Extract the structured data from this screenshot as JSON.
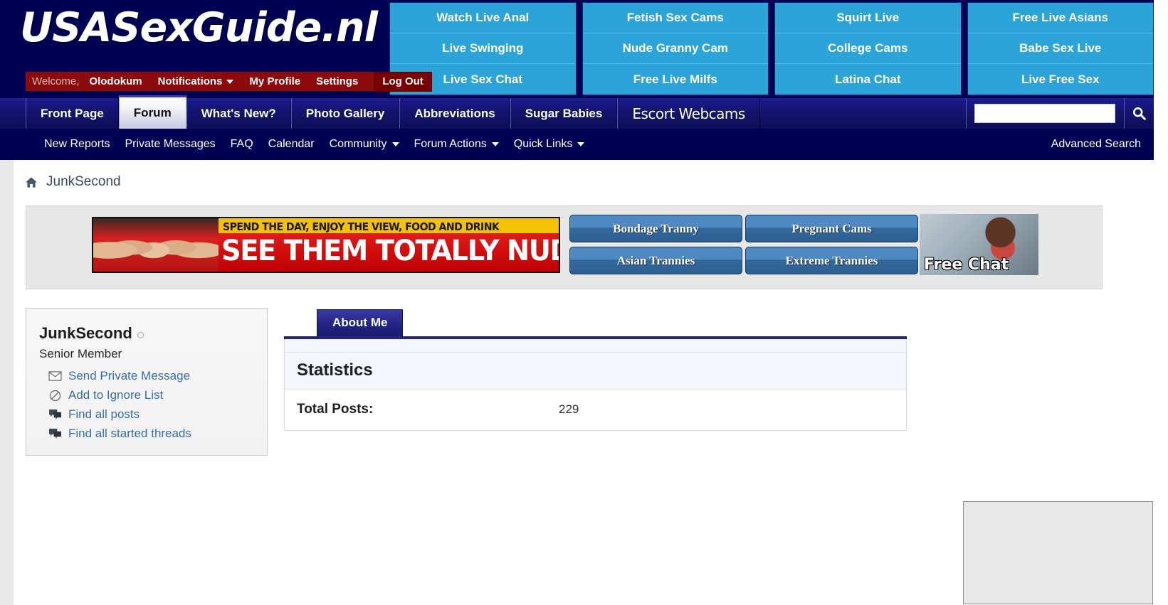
{
  "site": {
    "logo": "USASexGuide.nl"
  },
  "welcome_bar": {
    "greeting": "Welcome,",
    "username": "Olodokum",
    "items": [
      {
        "label": "Notifications",
        "icon": "chevron-down-icon",
        "has_caret": true
      },
      {
        "label": "My Profile",
        "has_caret": false
      },
      {
        "label": "Settings",
        "has_caret": false
      }
    ],
    "logout_label": "Log Out"
  },
  "top_ads": {
    "columns": [
      {
        "cells": [
          "Watch Live Anal",
          "Live Swinging",
          "Live Sex Chat"
        ]
      },
      {
        "cells": [
          "Fetish Sex Cams",
          "Nude Granny Cam",
          "Free Live Milfs"
        ]
      },
      {
        "cells": [
          "Squirt Live",
          "College Cams",
          "Latina Chat"
        ]
      },
      {
        "cells": [
          "Free Live Asians",
          "Babe Sex Live",
          "Live Free Sex"
        ]
      }
    ],
    "background_color": "#2ca3d9"
  },
  "nav": {
    "tabs": [
      {
        "label": "Front Page",
        "active": false,
        "style": "normal"
      },
      {
        "label": "Forum",
        "active": true,
        "style": "normal"
      },
      {
        "label": "What's New?",
        "active": false,
        "style": "normal"
      },
      {
        "label": "Photo Gallery",
        "active": false,
        "style": "normal"
      },
      {
        "label": "Abbreviations",
        "active": false,
        "style": "normal"
      },
      {
        "label": "Sugar Babies",
        "active": false,
        "style": "normal"
      },
      {
        "label": "Escort Webcams",
        "active": false,
        "style": "script"
      }
    ],
    "search": {
      "value": "",
      "placeholder": "",
      "button_icon": "search-icon"
    }
  },
  "subnav": {
    "items": [
      {
        "label": "New Reports",
        "has_caret": false
      },
      {
        "label": "Private Messages",
        "has_caret": false
      },
      {
        "label": "FAQ",
        "has_caret": false
      },
      {
        "label": "Calendar",
        "has_caret": false
      },
      {
        "label": "Community",
        "has_caret": true
      },
      {
        "label": "Forum Actions",
        "has_caret": true
      },
      {
        "label": "Quick Links",
        "has_caret": true
      }
    ],
    "advanced_search": "Advanced Search"
  },
  "breadcrumb": {
    "home_icon": "home-icon",
    "label": "JunkSecond"
  },
  "ad_strip": {
    "banner": {
      "line1": "SPEND THE DAY, ENJOY THE VIEW, FOOD AND DRINK",
      "line2": "SEE THEM TOTALLY NUDE"
    },
    "buttons": [
      "Bondage Tranny",
      "Pregnant Cams",
      "Asian Trannies",
      "Extreme Trannies"
    ],
    "free_chat_label": "Free Chat"
  },
  "user_card": {
    "username": "JunkSecond",
    "status_icon": "offline-status-icon",
    "member_title": "Senior Member",
    "links": [
      {
        "label": "Send Private Message",
        "icon": "envelope-icon"
      },
      {
        "label": "Add to Ignore List",
        "icon": "block-icon"
      },
      {
        "label": "Find all posts",
        "icon": "posts-icon"
      },
      {
        "label": "Find all started threads",
        "icon": "threads-icon"
      }
    ]
  },
  "profile": {
    "tabs": [
      {
        "label": "About Me",
        "active": true
      }
    ],
    "statistics": {
      "heading": "Statistics",
      "rows": [
        {
          "label": "Total Posts:",
          "value": "229"
        }
      ]
    }
  },
  "colors": {
    "header_navy": "#000055",
    "welcome_red": "#8e0b0b",
    "logout_red": "#7a0000",
    "ad_blue": "#2ca3d9",
    "tab_navy": "#232383",
    "link_blue": "#3a6ea5",
    "page_gray": "#e9e9e9"
  }
}
